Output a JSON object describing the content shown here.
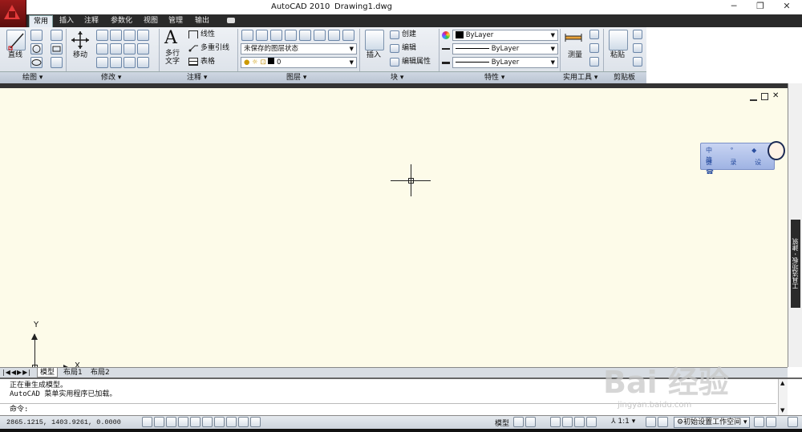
{
  "window": {
    "app_title": "AutoCAD 2010",
    "file_name": "Drawing1.dwg"
  },
  "tabs": [
    "常用",
    "插入",
    "注释",
    "参数化",
    "视图",
    "管理",
    "输出"
  ],
  "ribbon": {
    "draw": {
      "line_label": "直线",
      "panel_label": "绘图 ▾"
    },
    "modify": {
      "move_label": "移动",
      "panel_label": "修改 ▾"
    },
    "annotation": {
      "mtext_label": "多行\n文字",
      "linear_label": "线性",
      "mleader_label": "多重引线",
      "table_label": "表格",
      "panel_label": "注释 ▾"
    },
    "layers": {
      "state_value": "未保存的图层状态",
      "layer_value": "0",
      "panel_label": "图层 ▾"
    },
    "block": {
      "insert_label": "插入",
      "create_label": "创建",
      "edit_label": "编辑",
      "edit_attr_label": "编辑属性",
      "panel_label": "块 ▾"
    },
    "properties": {
      "color_value": "ByLayer",
      "linetype_value": "ByLayer",
      "lineweight_value": "ByLayer",
      "panel_label": "特性 ▾"
    },
    "utilities": {
      "measure_label": "测量",
      "panel_label": "实用工具 ▾"
    },
    "clipboard": {
      "paste_label": "粘贴",
      "panel_label": "剪贴板"
    }
  },
  "tool_palette_label": "工具选项板 - 建筑",
  "ucs": {
    "x_label": "X",
    "y_label": "Y"
  },
  "layout_tabs": [
    "模型",
    "布局1",
    "布局2"
  ],
  "command": {
    "history": [
      "正在重生成模型。",
      "AutoCAD 菜单实用程序已加载。"
    ],
    "prompt": "命令:"
  },
  "status": {
    "coords": "2865.1215, 1403.9261, 0.0000",
    "model_label": "模型",
    "scale_label": "1:1",
    "workspace_label": "初始设置工作空间"
  },
  "tray_widget": {
    "row1": "中 ° ◆ 简",
    "row2": "键 录 设 ☎"
  },
  "colors": {
    "canvas": "#fdfbe9",
    "tabbar": "#2a2a2a",
    "ribbon": "#dde3ea"
  },
  "watermark": {
    "brand": "Bai 经验",
    "url": "jingyan.baidu.com"
  }
}
